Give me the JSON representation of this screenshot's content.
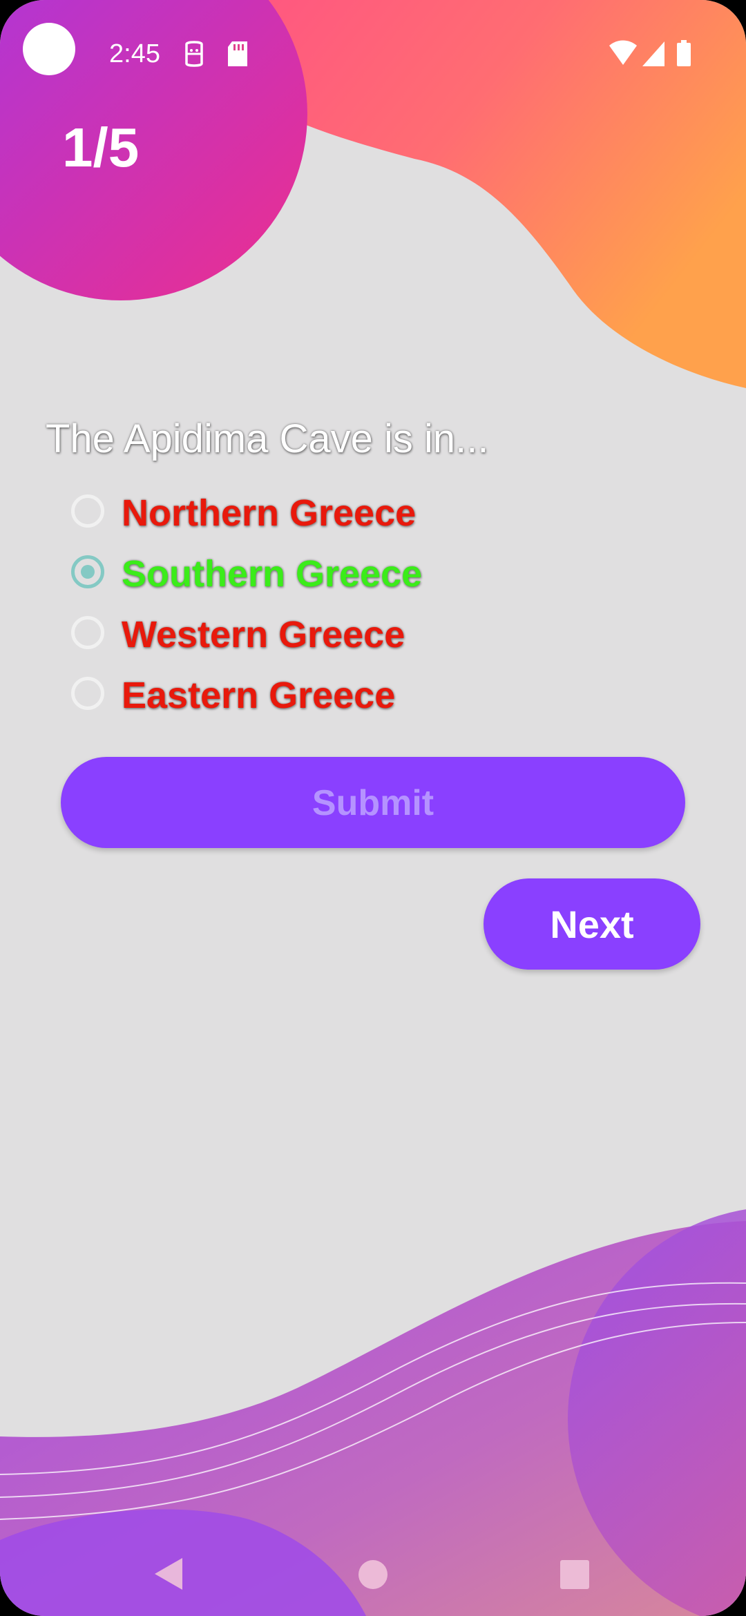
{
  "status_bar": {
    "time": "2:45",
    "icons": [
      "sim-status-icon",
      "sd-card-icon",
      "wifi-icon",
      "cell-signal-icon",
      "battery-icon"
    ]
  },
  "quiz": {
    "progress": "1/5",
    "question": "The Apidima Cave is in...",
    "options": [
      {
        "label": "Northern Greece",
        "checked": false,
        "color": "#e8190c"
      },
      {
        "label": "Southern Greece",
        "checked": true,
        "color": "#3bec1a"
      },
      {
        "label": "Western Greece",
        "checked": false,
        "color": "#e8190c"
      },
      {
        "label": "Eastern Greece",
        "checked": false,
        "color": "#e8190c"
      }
    ],
    "submit_label": "Submit",
    "next_label": "Next"
  },
  "colors": {
    "background": "#e0dfe0",
    "button": "#8a40ff",
    "submit_text_disabled": "#b593ff",
    "selected_radio": "#84c9c4"
  },
  "nav_bar": {
    "icons": [
      "back-icon",
      "home-icon",
      "recents-icon"
    ]
  }
}
